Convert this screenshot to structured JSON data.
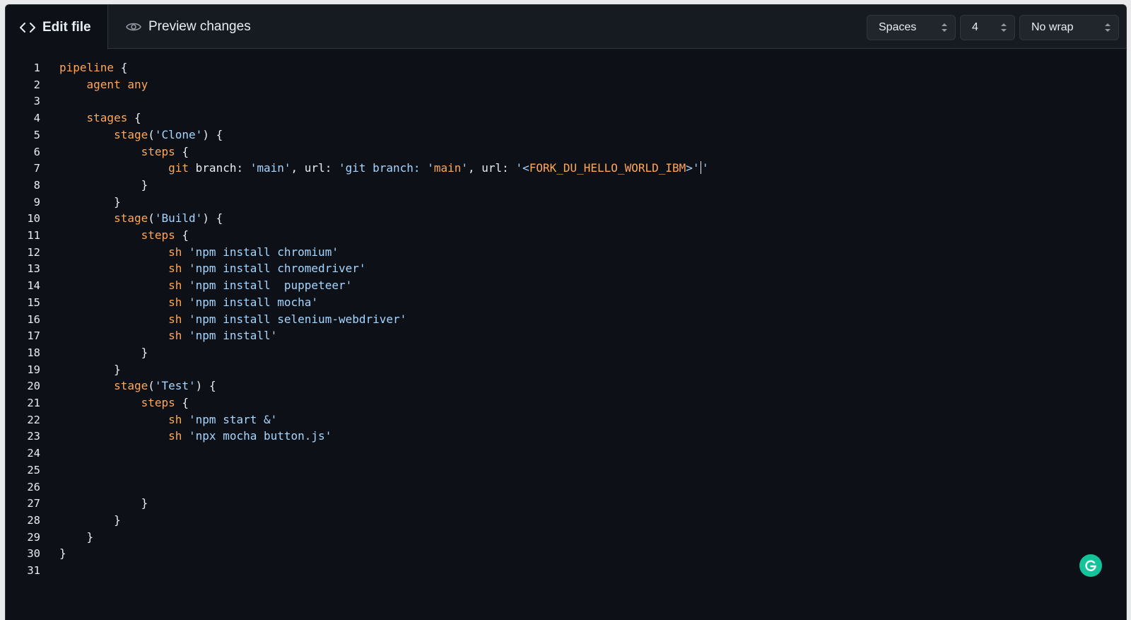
{
  "tabs": {
    "edit_label": "Edit file",
    "preview_label": "Preview changes"
  },
  "controls": {
    "indent_mode": "Spaces",
    "indent_size": "4",
    "wrap_mode": "No wrap"
  },
  "editor": {
    "lines": [
      {
        "n": "1",
        "indent": "",
        "parts": [
          [
            "kw",
            "pipeline"
          ],
          [
            "p",
            " {"
          ]
        ]
      },
      {
        "n": "2",
        "indent": "    ",
        "parts": [
          [
            "kw",
            "agent any"
          ]
        ]
      },
      {
        "n": "3",
        "indent": "",
        "parts": []
      },
      {
        "n": "4",
        "indent": "    ",
        "parts": [
          [
            "kw",
            "stages"
          ],
          [
            "p",
            " {"
          ]
        ]
      },
      {
        "n": "5",
        "indent": "        ",
        "parts": [
          [
            "kw",
            "stage"
          ],
          [
            "p",
            "("
          ],
          [
            "str",
            "'Clone'"
          ],
          [
            "p",
            ") {"
          ]
        ]
      },
      {
        "n": "6",
        "indent": "            ",
        "parts": [
          [
            "kw",
            "steps"
          ],
          [
            "p",
            " {"
          ]
        ]
      },
      {
        "n": "7",
        "indent": "                ",
        "parts": [
          [
            "kw",
            "git"
          ],
          [
            "p",
            " branch: "
          ],
          [
            "str",
            "'main'"
          ],
          [
            "p",
            ", url: "
          ],
          [
            "str",
            "'git branch: '"
          ],
          [
            "kw",
            "main"
          ],
          [
            "str",
            "'"
          ],
          [
            "p",
            ", url: "
          ],
          [
            "str",
            "'<"
          ],
          [
            "kw",
            "FORK_DU_HELLO_WORLD_IBM"
          ],
          [
            "str",
            ">'"
          ],
          [
            "cursor",
            ""
          ],
          [
            "str",
            "'"
          ]
        ]
      },
      {
        "n": "8",
        "indent": "            ",
        "parts": [
          [
            "p",
            "}"
          ]
        ]
      },
      {
        "n": "9",
        "indent": "        ",
        "parts": [
          [
            "p",
            "}"
          ]
        ]
      },
      {
        "n": "10",
        "indent": "        ",
        "parts": [
          [
            "kw",
            "stage"
          ],
          [
            "p",
            "("
          ],
          [
            "str",
            "'Build'"
          ],
          [
            "p",
            ") {"
          ]
        ]
      },
      {
        "n": "11",
        "indent": "            ",
        "parts": [
          [
            "kw",
            "steps"
          ],
          [
            "p",
            " {"
          ]
        ]
      },
      {
        "n": "12",
        "indent": "                ",
        "parts": [
          [
            "kw",
            "sh"
          ],
          [
            "p",
            " "
          ],
          [
            "str",
            "'npm install chromium'"
          ]
        ]
      },
      {
        "n": "13",
        "indent": "                ",
        "parts": [
          [
            "kw",
            "sh"
          ],
          [
            "p",
            " "
          ],
          [
            "str",
            "'npm install chromedriver'"
          ]
        ]
      },
      {
        "n": "14",
        "indent": "                ",
        "parts": [
          [
            "kw",
            "sh"
          ],
          [
            "p",
            " "
          ],
          [
            "str",
            "'npm install  puppeteer'"
          ]
        ]
      },
      {
        "n": "15",
        "indent": "                ",
        "parts": [
          [
            "kw",
            "sh"
          ],
          [
            "p",
            " "
          ],
          [
            "str",
            "'npm install mocha'"
          ]
        ]
      },
      {
        "n": "16",
        "indent": "                ",
        "parts": [
          [
            "kw",
            "sh"
          ],
          [
            "p",
            " "
          ],
          [
            "str",
            "'npm install selenium-webdriver'"
          ]
        ]
      },
      {
        "n": "17",
        "indent": "                ",
        "parts": [
          [
            "kw",
            "sh"
          ],
          [
            "p",
            " "
          ],
          [
            "str",
            "'npm install'"
          ]
        ]
      },
      {
        "n": "18",
        "indent": "            ",
        "parts": [
          [
            "p",
            "}"
          ]
        ]
      },
      {
        "n": "19",
        "indent": "        ",
        "parts": [
          [
            "p",
            "}"
          ]
        ]
      },
      {
        "n": "20",
        "indent": "        ",
        "parts": [
          [
            "kw",
            "stage"
          ],
          [
            "p",
            "("
          ],
          [
            "str",
            "'Test'"
          ],
          [
            "p",
            ") {"
          ]
        ]
      },
      {
        "n": "21",
        "indent": "            ",
        "parts": [
          [
            "kw",
            "steps"
          ],
          [
            "p",
            " {"
          ]
        ]
      },
      {
        "n": "22",
        "indent": "                ",
        "parts": [
          [
            "kw",
            "sh"
          ],
          [
            "p",
            " "
          ],
          [
            "str",
            "'npm start &'"
          ]
        ]
      },
      {
        "n": "23",
        "indent": "                ",
        "parts": [
          [
            "kw",
            "sh"
          ],
          [
            "p",
            " "
          ],
          [
            "str",
            "'npx mocha button.js'"
          ]
        ]
      },
      {
        "n": "24",
        "indent": "",
        "parts": []
      },
      {
        "n": "25",
        "indent": "",
        "parts": []
      },
      {
        "n": "26",
        "indent": "",
        "parts": []
      },
      {
        "n": "27",
        "indent": "            ",
        "parts": [
          [
            "p",
            "}"
          ]
        ]
      },
      {
        "n": "28",
        "indent": "        ",
        "parts": [
          [
            "p",
            "}"
          ]
        ]
      },
      {
        "n": "29",
        "indent": "    ",
        "parts": [
          [
            "p",
            "}"
          ]
        ]
      },
      {
        "n": "30",
        "indent": "",
        "parts": [
          [
            "p",
            "}"
          ]
        ]
      },
      {
        "n": "31",
        "indent": "",
        "parts": []
      }
    ]
  },
  "colors": {
    "background": "#0d1117",
    "keyword": "#ffa657",
    "string": "#a5d6ff",
    "text": "#e6edf3",
    "grammarly": "#15c39a"
  },
  "icons": {
    "edit_tab": "code-brackets-icon",
    "preview_tab": "eye-icon",
    "select_arrows": "chevron-up-down-icon",
    "assistant": "grammarly-icon"
  }
}
